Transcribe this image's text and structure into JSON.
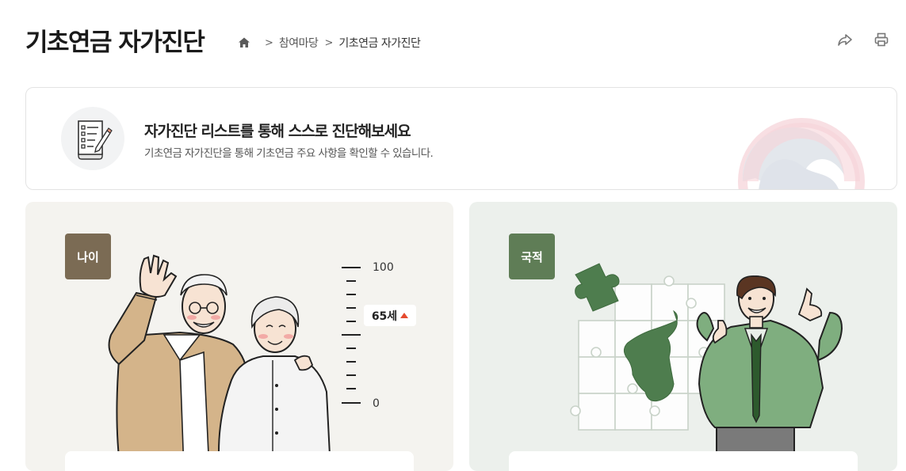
{
  "header": {
    "title": "기초연금 자가진단",
    "breadcrumb": [
      {
        "label": "참여마당"
      },
      {
        "label": "기초연금 자가진단"
      }
    ],
    "icons": {
      "home": "home-icon",
      "share": "share-icon",
      "print": "print-icon"
    }
  },
  "intro": {
    "heading": "자가진단 리스트를 통해 스스로 진단해보세요",
    "subtext": "기초연금 자가진단을 통해 기초연금 주요 사항을 확인할 수 있습니다.",
    "icon": "checklist-icon"
  },
  "cards": [
    {
      "tag": "나이",
      "scale_max": "100",
      "scale_min": "0",
      "badge": "65세",
      "illustration": "elderly-couple-illustration"
    },
    {
      "tag": "국적",
      "illustration": "korea-puzzle-man-illustration"
    }
  ],
  "colors": {
    "age_bg": "#f4f3ef",
    "age_tag": "#7b6b54",
    "nat_bg": "#ecf0ec",
    "nat_tag": "#5f7d56",
    "accent_red": "#e54a2e"
  }
}
